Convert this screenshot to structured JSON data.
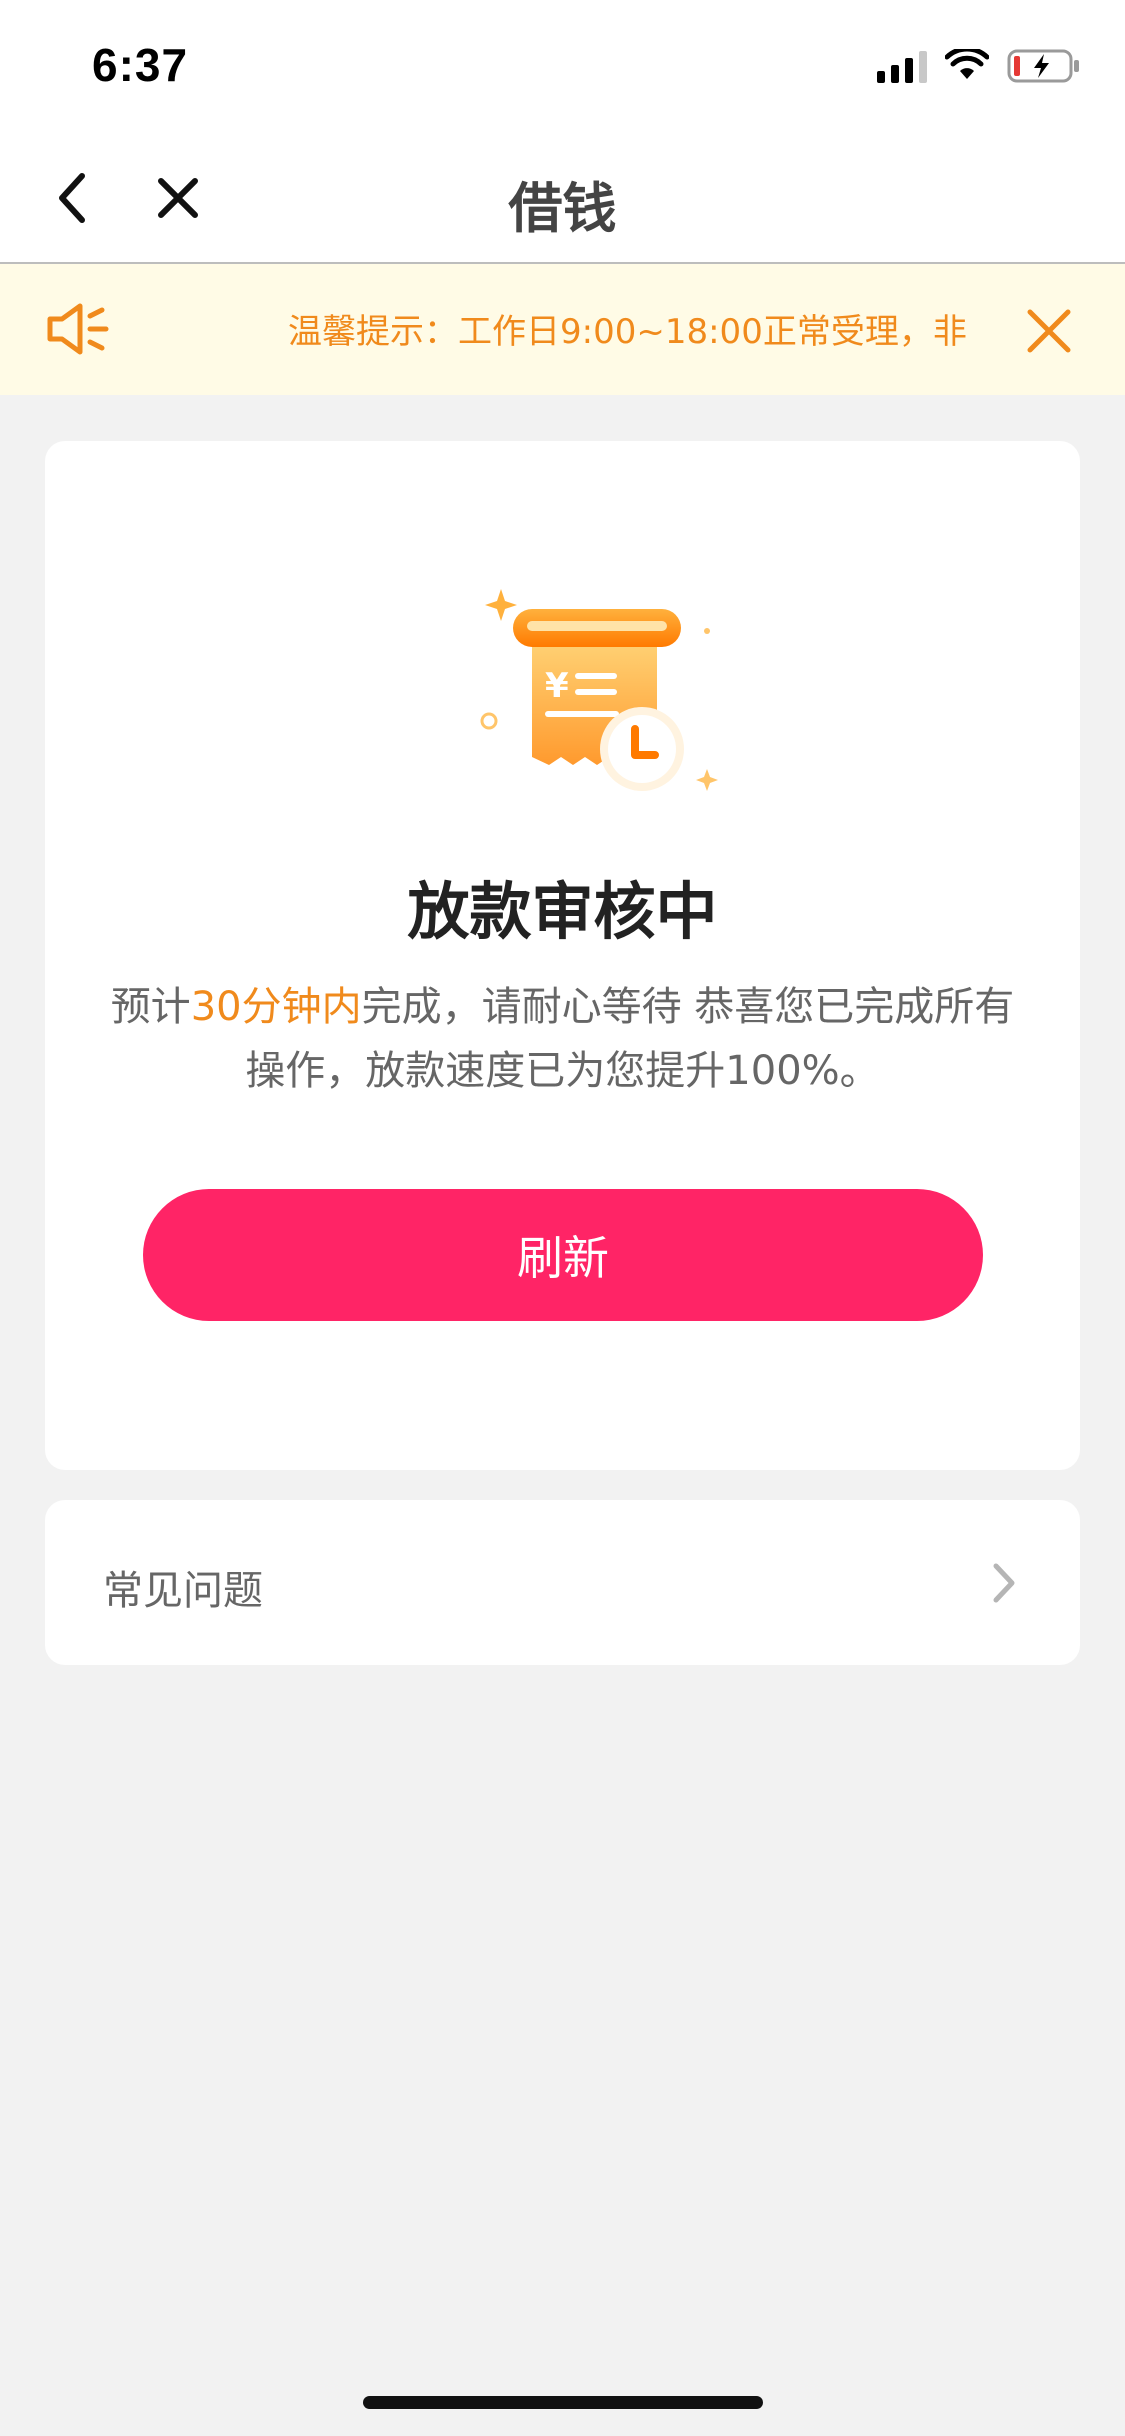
{
  "status_bar": {
    "time": "6:37"
  },
  "nav": {
    "title": "借钱"
  },
  "notice": {
    "text": "温馨提示：工作日9:00~18:00正常受理，非"
  },
  "status_card": {
    "title": "放款审核中",
    "desc_prefix": "预计",
    "desc_highlight": "30分钟内",
    "desc_suffix": "完成，请耐心等待 恭喜您已完成所有操作，放款速度已为您提升100%。",
    "refresh_label": "刷新"
  },
  "faq": {
    "label": "常见问题"
  },
  "colors": {
    "accent": "#ff2466",
    "notice_text": "#f08a1c",
    "notice_bg": "#fffbe6",
    "page_bg": "#f2f2f2"
  },
  "icons": {
    "back": "chevron-left-icon",
    "close": "close-icon",
    "notice": "speaker-icon",
    "notice_close": "close-icon",
    "faq": "chevron-right-icon",
    "illustration": "receipt-clock-icon"
  }
}
